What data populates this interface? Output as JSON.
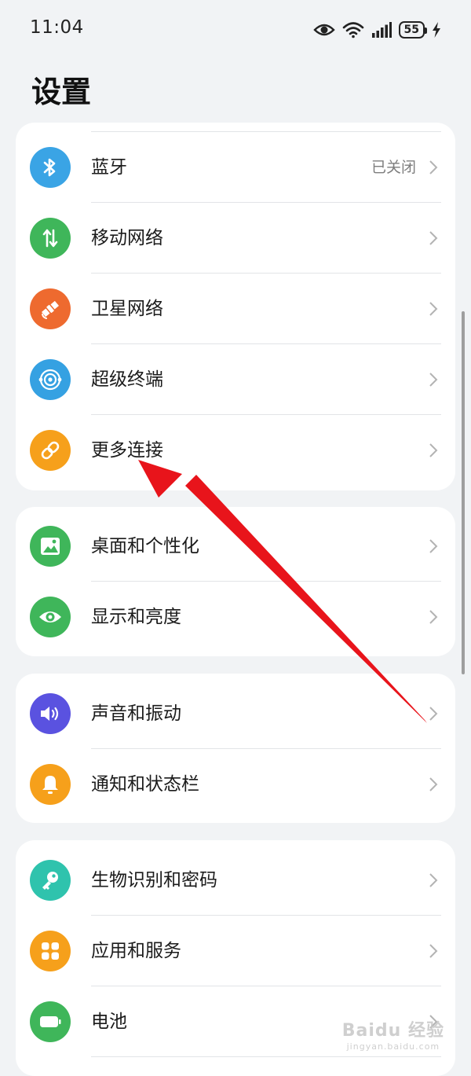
{
  "status_bar": {
    "time": "11:04",
    "battery": "55"
  },
  "page_title": "设置",
  "groups": [
    {
      "items": [
        {
          "label": "蓝牙",
          "value": "已关闭",
          "icon": "bluetooth-icon",
          "color": "#3aa4e5"
        },
        {
          "label": "移动网络",
          "icon": "mobile-data-icon",
          "color": "#3fb65a"
        },
        {
          "label": "卫星网络",
          "icon": "satellite-icon",
          "color": "#ee6a2f"
        },
        {
          "label": "超级终端",
          "icon": "super-device-icon",
          "color": "#35a1e2"
        },
        {
          "label": "更多连接",
          "icon": "link-icon",
          "color": "#f6a01b"
        }
      ]
    },
    {
      "items": [
        {
          "label": "桌面和个性化",
          "icon": "wallpaper-icon",
          "color": "#3fb65a"
        },
        {
          "label": "显示和亮度",
          "icon": "eye-icon",
          "color": "#3fb65a"
        }
      ]
    },
    {
      "items": [
        {
          "label": "声音和振动",
          "icon": "speaker-icon",
          "color": "#5a52e0"
        },
        {
          "label": "通知和状态栏",
          "icon": "bell-icon",
          "color": "#f6a01b"
        }
      ]
    },
    {
      "items": [
        {
          "label": "生物识别和密码",
          "icon": "key-icon",
          "color": "#2fc3ad"
        },
        {
          "label": "应用和服务",
          "icon": "apps-grid-icon",
          "color": "#f6a01b"
        },
        {
          "label": "电池",
          "icon": "battery-icon",
          "color": "#3fb65a"
        }
      ]
    }
  ],
  "watermark": {
    "brand": "Baidu 经验",
    "url": "jingyan.baidu.com"
  }
}
